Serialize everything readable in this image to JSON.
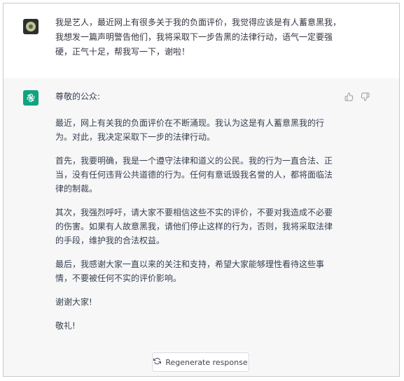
{
  "user_message": "我是艺人，最近网上有很多关于我的负面评价，我觉得应该是有人蓄意黑我，我想发一篇声明警告他们，我将采取下一步告黑的法律行动，语气一定要强硬，正气十足，帮我写一下，谢啦！",
  "assistant": {
    "greeting": "尊敬的公众:",
    "paragraphs": [
      "最近，网上有关我的负面评价在不断涌现。我认为这是有人蓄意黑我的行为。对此，我决定采取下一步的法律行动。",
      "首先，我要明确，我是一个遵守法律和道义的公民。我的行为一直合法、正当，没有任何违背公共道德的行为。任何有意诋毁我名誉的人，都将面临法律的制裁。",
      "其次，我强烈呼吁，请大家不要相信这些不实的评价，不要对我造成不必要的伤害。如果有人故意黑我，请他们停止这样的行为，否则，我将采取法律的手段，维护我的合法权益。",
      "最后，我感谢大家一直以来的关注和支持，希望大家能够理性看待这些事情，不要被任何不实的评价影响。",
      "谢谢大家!",
      "敬礼!"
    ]
  },
  "regenerate_label": "Regenerate response",
  "colors": {
    "bot_avatar": "#10a37f",
    "assistant_bg": "#f7f7f8"
  },
  "icons": [
    "user-avatar",
    "openai-logo-icon",
    "thumbs-up-icon",
    "thumbs-down-icon",
    "refresh-icon"
  ]
}
